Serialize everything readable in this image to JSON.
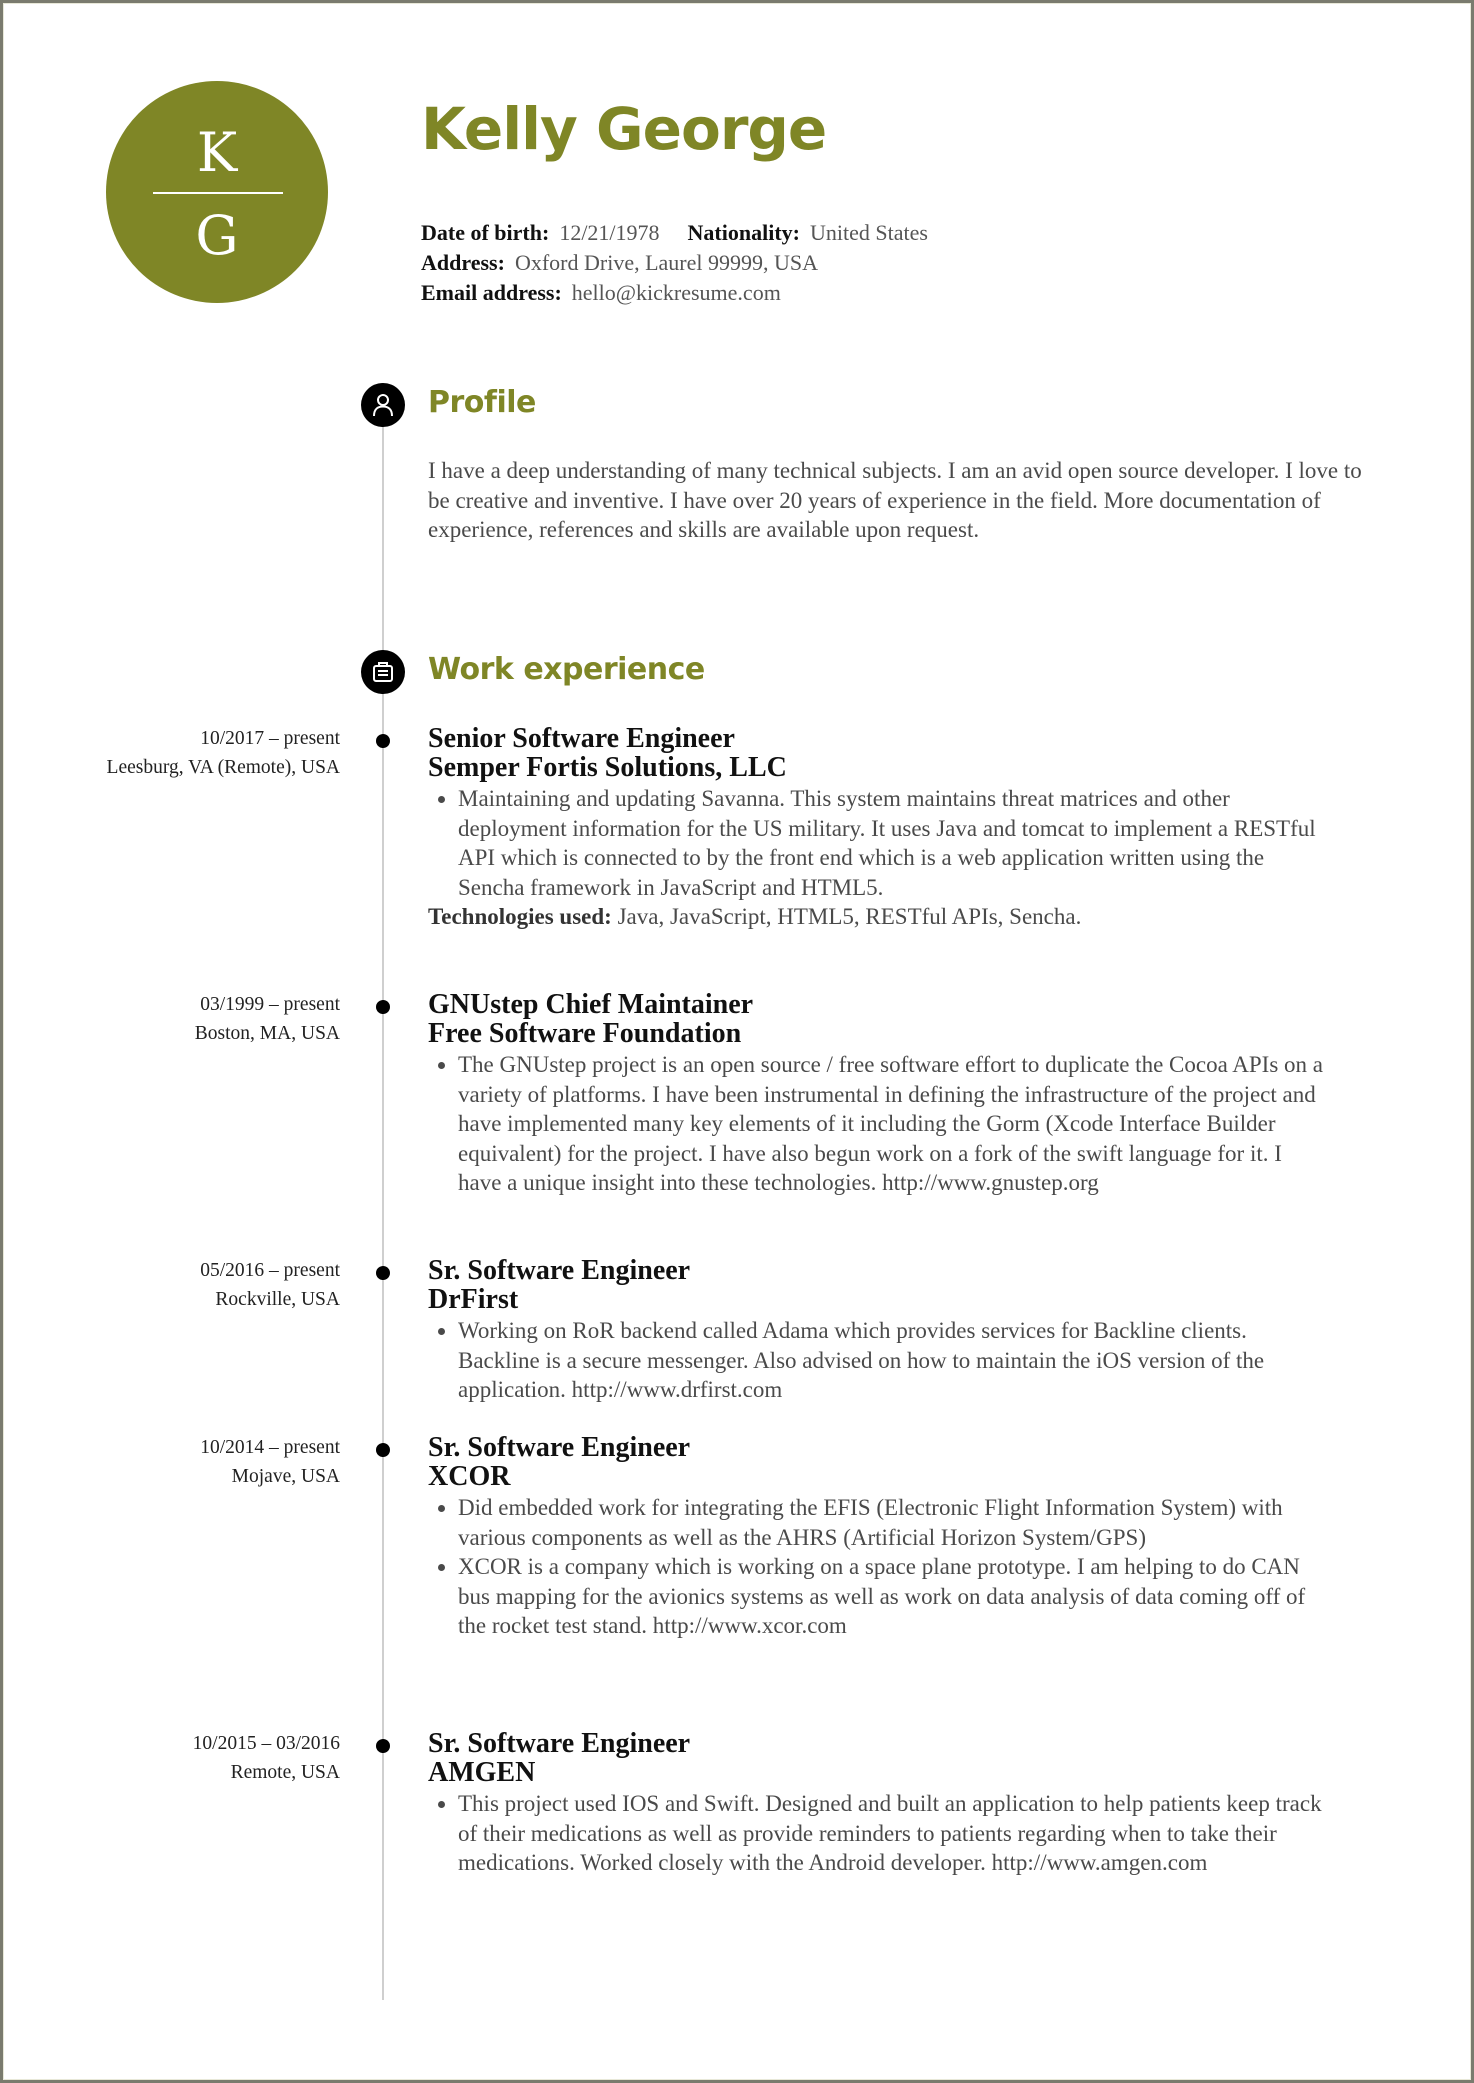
{
  "header": {
    "monogram": {
      "top": "K",
      "bottom": "G"
    },
    "name": "Kelly George",
    "details": {
      "dob_label": "Date of birth:",
      "dob": "12/21/1978",
      "nationality_label": "Nationality:",
      "nationality": "United States",
      "address_label": "Address:",
      "address": "Oxford Drive, Laurel 99999, USA",
      "email_label": "Email address:",
      "email": "hello@kickresume.com"
    }
  },
  "theme": {
    "accent": "#7f8626",
    "text": "#4a4a4a",
    "heading": "#111111"
  },
  "profile": {
    "title": "Profile",
    "icon": "person-icon",
    "text": "I have a deep understanding of many technical subjects. I am an avid open source developer. I love to be creative and inventive. I have over 20 years of experience in the field. More documentation of experience, references and skills are available upon request."
  },
  "work": {
    "title": "Work experience",
    "icon": "briefcase-icon",
    "jobs": [
      {
        "dates": "10/2017 – present",
        "location": "Leesburg, VA (Remote), USA",
        "title": "Senior Software Engineer",
        "company": "Semper Fortis Solutions, LLC",
        "bullets": [
          "Maintaining and updating Savanna. This system maintains threat matrices and other deployment information for the US military. It uses Java and tomcat to implement a RESTful API which is connected to by the front end which is a web application written using the Sencha framework in JavaScript and HTML5."
        ],
        "tech_label": "Technologies used:",
        "tech": "Java, JavaScript, HTML5, RESTful APIs, Sencha."
      },
      {
        "dates": "03/1999 – present",
        "location": "Boston, MA, USA",
        "title": "GNUstep Chief Maintainer",
        "company": "Free Software Foundation",
        "bullets": [
          "The GNUstep project is an open source / free software effort to duplicate the Cocoa APIs on a variety of platforms. I have been instrumental in defining the infrastructure of the project and have implemented many key elements of it including the Gorm (Xcode Interface Builder equivalent) for the project. I have also begun work on a fork of the swift language for it. I have a unique insight into these technologies. http://www.gnustep.org"
        ]
      },
      {
        "dates": "05/2016 – present",
        "location": "Rockville, USA",
        "title": "Sr. Software Engineer",
        "company": "DrFirst",
        "bullets": [
          "Working on RoR backend called Adama which provides services for Backline clients. Backline is a secure messenger. Also advised on how to maintain the iOS version of the application. http://www.drfirst.com"
        ]
      },
      {
        "dates": "10/2014 – present",
        "location": "Mojave, USA",
        "title": "Sr. Software Engineer",
        "company": "XCOR",
        "bullets": [
          "Did embedded work for integrating the EFIS (Electronic Flight Information System) with various components as well as the AHRS (Artificial Horizon System/GPS)",
          "XCOR is a company which is working on a space plane prototype.   I am helping to do CAN bus mapping for the avionics systems as well as work on data analysis of data coming off of the rocket test stand. http://www.xcor.com"
        ]
      },
      {
        "dates": "10/2015 – 03/2016",
        "location": "Remote, USA",
        "title": "Sr. Software Engineer",
        "company": "AMGEN",
        "bullets": [
          "This project used IOS and Swift. Designed and built an application to help patients keep track of their medications as well as provide reminders to patients regarding when to take their medications.  Worked closely with the Android developer.  http://www.amgen.com"
        ]
      }
    ]
  }
}
